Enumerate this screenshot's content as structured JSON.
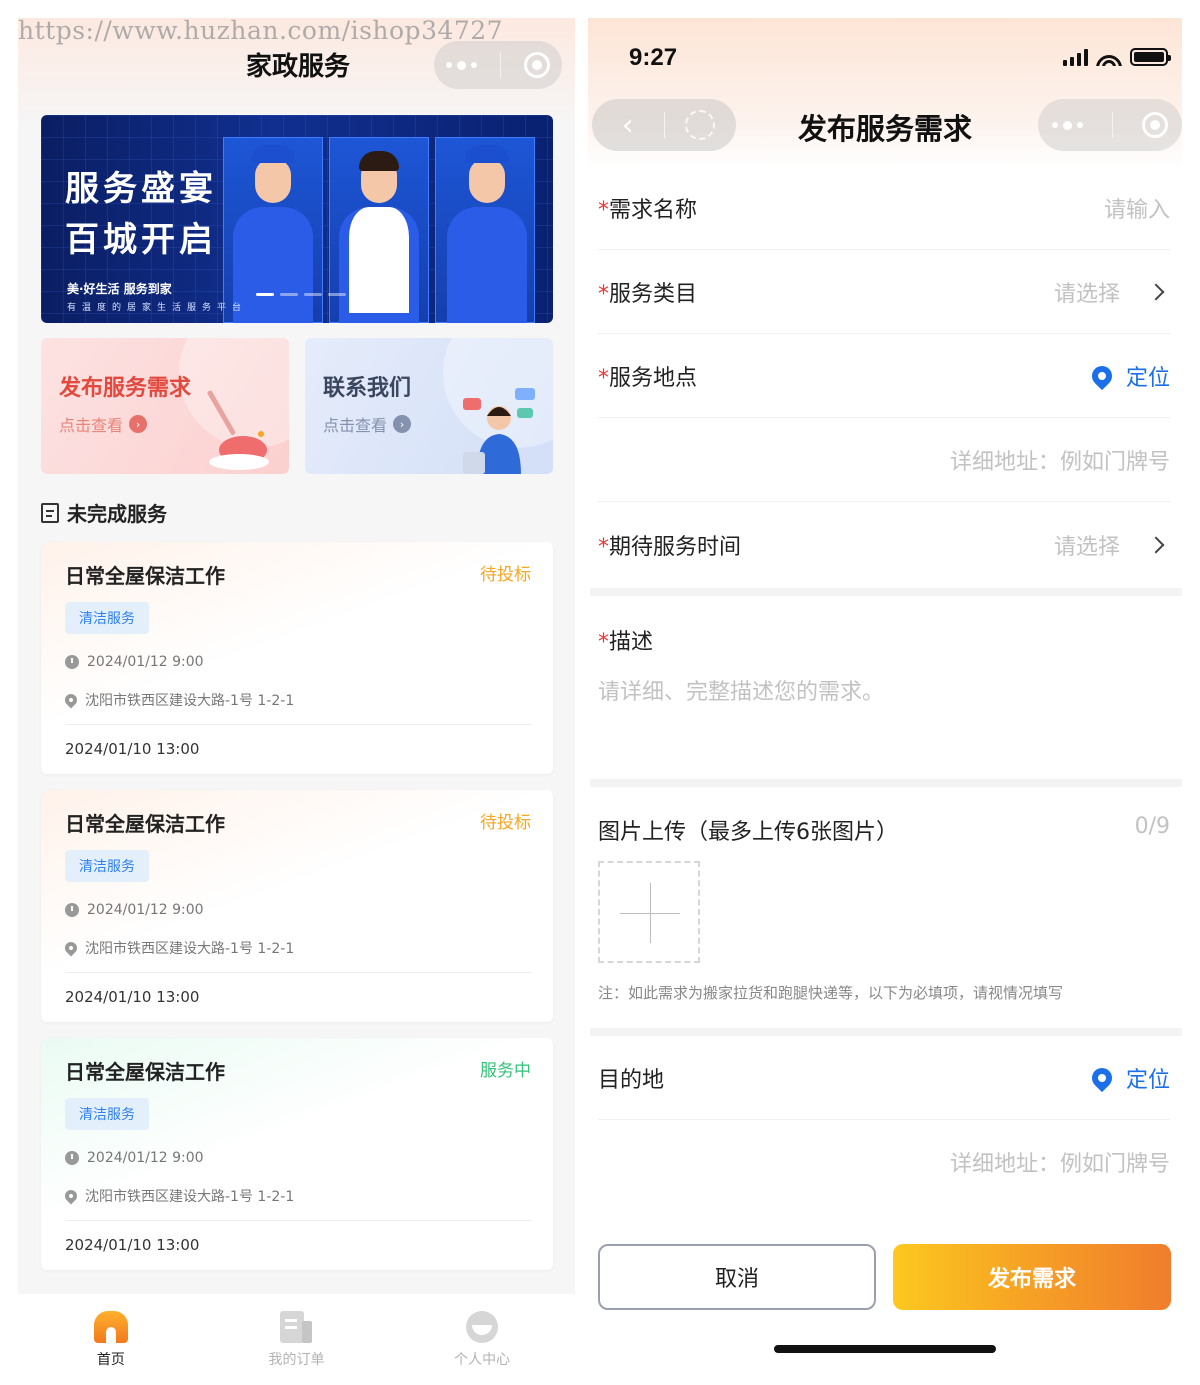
{
  "watermark": "https://www.huzhan.com/ishop34727",
  "left_screen": {
    "title": "家政服务",
    "banner": {
      "headline_1": "服务盛宴",
      "headline_2": "百城开启",
      "brand_line": "美·好生活 服务到家",
      "tagline": "有温度的居家生活服务平台"
    },
    "entries": [
      {
        "title": "发布服务需求",
        "subtitle": "点击查看"
      },
      {
        "title": "联系我们",
        "subtitle": "点击查看"
      }
    ],
    "section_title": "未完成服务",
    "cards": [
      {
        "title": "日常全屋保洁工作",
        "status": "待投标",
        "category": "清洁服务",
        "service_time": "2024/01/12 9:00",
        "address": "沈阳市铁西区建设大路-1号 1-2-1",
        "created": "2024/01/10 13:00"
      },
      {
        "title": "日常全屋保洁工作",
        "status": "待投标",
        "category": "清洁服务",
        "service_time": "2024/01/12 9:00",
        "address": "沈阳市铁西区建设大路-1号 1-2-1",
        "created": "2024/01/10 13:00"
      },
      {
        "title": "日常全屋保洁工作",
        "status": "服务中",
        "category": "清洁服务",
        "service_time": "2024/01/12 9:00",
        "address": "沈阳市铁西区建设大路-1号 1-2-1",
        "created": "2024/01/10 13:00"
      }
    ],
    "tabbar": [
      {
        "label": "首页",
        "icon": "home-icon",
        "active": true
      },
      {
        "label": "我的订单",
        "icon": "order-icon",
        "active": false
      },
      {
        "label": "个人中心",
        "icon": "profile-icon",
        "active": false
      }
    ]
  },
  "right_screen": {
    "status_time": "9:27",
    "title": "发布服务需求",
    "required_mark": "*",
    "fields": {
      "name": {
        "label": "需求名称",
        "placeholder": "请输入"
      },
      "category": {
        "label": "服务类目",
        "placeholder": "请选择"
      },
      "location": {
        "label": "服务地点",
        "action": "定位"
      },
      "address_detail": {
        "placeholder": "详细地址：例如门牌号"
      },
      "time": {
        "label": "期待服务时间",
        "placeholder": "请选择"
      },
      "description": {
        "label": "描述",
        "placeholder": "请详细、完整描述您的需求。"
      }
    },
    "upload": {
      "label": "图片上传（最多上传6张图片）",
      "count": "0/9"
    },
    "note": "注：如此需求为搬家拉货和跑腿快递等，以下为必填项，请视情况填写",
    "destination": {
      "label": "目的地",
      "action": "定位",
      "address_placeholder": "详细地址：例如门牌号"
    },
    "buttons": {
      "cancel": "取消",
      "submit": "发布需求"
    }
  },
  "colors": {
    "accent_orange": "#f5a623",
    "status_green": "#36c27a",
    "link_blue": "#1b6fe8",
    "required_red": "#e53935",
    "banner_navy": "#0b1e63"
  }
}
